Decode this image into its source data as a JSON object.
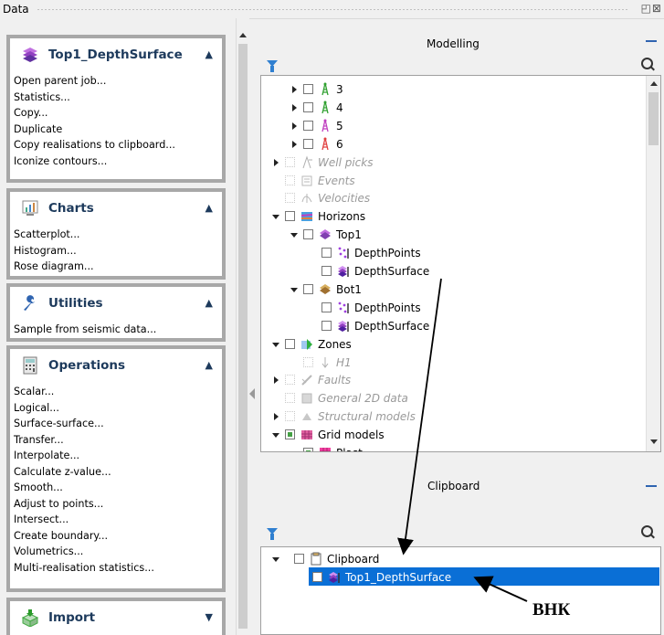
{
  "window": {
    "title": "Data",
    "buttons": "◰⊠"
  },
  "left_panel": {
    "sections": [
      {
        "title": "Top1_DepthSurface",
        "icon": "depth-surface-icon",
        "expanded": true,
        "items": [
          "Open parent job...",
          "Statistics...",
          "Copy...",
          "Duplicate",
          "Copy realisations to clipboard...",
          "Iconize contours..."
        ]
      },
      {
        "title": "Charts",
        "icon": "chart-icon",
        "expanded": true,
        "items": [
          "Scatterplot...",
          "Histogram...",
          "Rose diagram..."
        ]
      },
      {
        "title": "Utilities",
        "icon": "wrench-icon",
        "expanded": true,
        "items": [
          "Sample from seismic data..."
        ]
      },
      {
        "title": "Operations",
        "icon": "calculator-icon",
        "expanded": true,
        "items": [
          "Scalar...",
          "Logical...",
          "Surface-surface...",
          "Transfer...",
          "Interpolate...",
          "Calculate z-value...",
          "Smooth...",
          "Adjust to points...",
          "Intersect...",
          "Create boundary...",
          "Volumetrics...",
          "Multi-realisation statistics..."
        ]
      },
      {
        "title": "Import",
        "icon": "import-icon",
        "expanded": false,
        "items": []
      }
    ]
  },
  "modelling": {
    "title": "Modelling",
    "rows": [
      {
        "label": "3",
        "arrow": "right",
        "icon": "well-icon",
        "disabled": false
      },
      {
        "label": "4",
        "arrow": "right",
        "icon": "well-icon",
        "disabled": false
      },
      {
        "label": "5",
        "arrow": "right",
        "icon": "well-icon",
        "disabled": false
      },
      {
        "label": "6",
        "arrow": "right",
        "icon": "well-icon",
        "disabled": false
      },
      {
        "label": "Well picks",
        "arrow": "right",
        "icon": "well-picks-icon",
        "disabled": true
      },
      {
        "label": "Events",
        "arrow": "none",
        "icon": "events-icon",
        "disabled": true
      },
      {
        "label": "Velocities",
        "arrow": "none",
        "icon": "velocities-icon",
        "disabled": true
      },
      {
        "label": "Horizons",
        "arrow": "down",
        "icon": "horizons-icon",
        "disabled": false
      },
      {
        "label": "Top1",
        "arrow": "down",
        "icon": "horizon-top-icon",
        "disabled": false
      },
      {
        "label": "DepthPoints",
        "arrow": "none",
        "icon": "depth-points-icon",
        "disabled": false
      },
      {
        "label": "DepthSurface",
        "arrow": "none",
        "icon": "depth-surface-icon",
        "disabled": false
      },
      {
        "label": "Bot1",
        "arrow": "down",
        "icon": "horizon-bot-icon",
        "disabled": false
      },
      {
        "label": "DepthPoints",
        "arrow": "none",
        "icon": "depth-points-icon",
        "disabled": false
      },
      {
        "label": "DepthSurface",
        "arrow": "none",
        "icon": "depth-surface-icon",
        "disabled": false
      },
      {
        "label": "Zones",
        "arrow": "down",
        "icon": "zones-icon",
        "disabled": false
      },
      {
        "label": "H1",
        "arrow": "none",
        "icon": "zone-arrow-icon",
        "disabled": true
      },
      {
        "label": "Faults",
        "arrow": "right",
        "icon": "faults-icon",
        "disabled": true
      },
      {
        "label": "General 2D data",
        "arrow": "none",
        "icon": "general-2d-icon",
        "disabled": true
      },
      {
        "label": "Structural models",
        "arrow": "right",
        "icon": "structural-models-icon",
        "disabled": true
      },
      {
        "label": "Grid models",
        "arrow": "down",
        "icon": "grid-models-icon",
        "disabled": false
      },
      {
        "label": "Plast",
        "arrow": "down",
        "icon": "plast-icon",
        "disabled": false
      }
    ]
  },
  "clipboard": {
    "title": "Clipboard",
    "rows": [
      {
        "label": "Clipboard",
        "arrow": "down",
        "icon": "clipboard-icon"
      },
      {
        "label": "Top1_DepthSurface",
        "arrow": "none",
        "icon": "depth-surface-icon",
        "selected": true
      }
    ]
  },
  "annotation": {
    "label": "ВНК"
  },
  "colors": {
    "selection": "#0a6fd6",
    "section_title": "#1d3a5c",
    "accent": "#2f64b0"
  }
}
